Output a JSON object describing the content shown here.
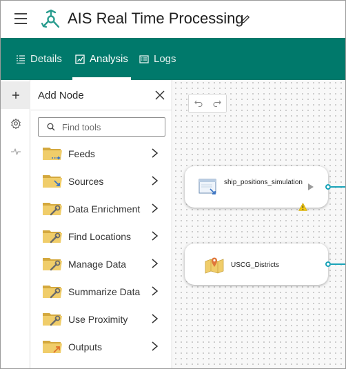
{
  "header": {
    "title": "AIS Real Time Processing"
  },
  "nav": {
    "tabs": [
      {
        "label": "Details",
        "icon": "details-icon"
      },
      {
        "label": "Analysis",
        "icon": "analysis-icon",
        "active": true
      },
      {
        "label": "Logs",
        "icon": "logs-icon"
      }
    ]
  },
  "rail": {
    "items": [
      "add-node-icon",
      "settings-icon",
      "activity-icon"
    ]
  },
  "add_node": {
    "title": "Add Node",
    "search_placeholder": "Find tools",
    "items": [
      {
        "label": "Feeds",
        "badge": "feed-badge"
      },
      {
        "label": "Sources",
        "badge": "arrow-badge"
      },
      {
        "label": "Data Enrichment",
        "badge": "wrench-badge"
      },
      {
        "label": "Find Locations",
        "badge": "wrench-badge"
      },
      {
        "label": "Manage Data",
        "badge": "wrench-badge"
      },
      {
        "label": "Summarize Data",
        "badge": "wrench-badge"
      },
      {
        "label": "Use Proximity",
        "badge": "wrench-badge"
      },
      {
        "label": "Outputs",
        "badge": "orange-arrow-badge"
      }
    ]
  },
  "canvas": {
    "nodes": [
      {
        "label": "ship_positions_simulation",
        "icon": "feed-source-icon",
        "warning": true
      },
      {
        "label": "USCG_Districts",
        "icon": "map-pin-icon"
      }
    ]
  },
  "colors": {
    "nav_bg": "#00796b",
    "accent": "#19a3b8",
    "folder": "#e9c159",
    "warning": "#f2c811"
  }
}
